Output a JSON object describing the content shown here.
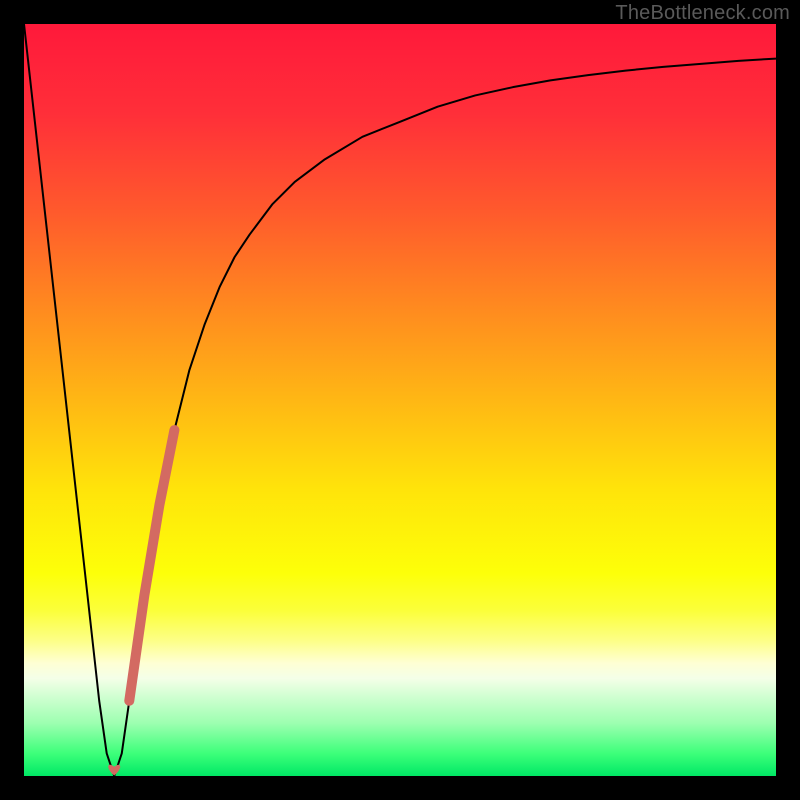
{
  "watermark": "TheBottleneck.com",
  "chart_data": {
    "type": "line",
    "title": "",
    "xlabel": "",
    "ylabel": "",
    "xlim": [
      0,
      100
    ],
    "ylim": [
      0,
      100
    ],
    "gradient_stops": [
      {
        "offset": 0.0,
        "color": "#ff193a"
      },
      {
        "offset": 0.12,
        "color": "#ff2f39"
      },
      {
        "offset": 0.25,
        "color": "#ff5a2c"
      },
      {
        "offset": 0.38,
        "color": "#ff8b1f"
      },
      {
        "offset": 0.5,
        "color": "#ffb714"
      },
      {
        "offset": 0.62,
        "color": "#ffe40a"
      },
      {
        "offset": 0.73,
        "color": "#fdff09"
      },
      {
        "offset": 0.78,
        "color": "#fbff3a"
      },
      {
        "offset": 0.82,
        "color": "#fdff87"
      },
      {
        "offset": 0.85,
        "color": "#feffd4"
      },
      {
        "offset": 0.87,
        "color": "#f4ffe8"
      },
      {
        "offset": 0.93,
        "color": "#9cffb0"
      },
      {
        "offset": 0.97,
        "color": "#3dff7a"
      },
      {
        "offset": 1.0,
        "color": "#00e865"
      }
    ],
    "series": [
      {
        "name": "main-curve",
        "color": "#000000",
        "width": 2.0,
        "x": [
          0,
          1,
          2,
          3,
          4,
          5,
          6,
          7,
          8,
          9,
          10,
          11,
          12,
          13,
          14,
          15,
          16,
          17,
          18,
          20,
          22,
          24,
          26,
          28,
          30,
          33,
          36,
          40,
          45,
          50,
          55,
          60,
          65,
          70,
          75,
          80,
          85,
          90,
          95,
          100
        ],
        "y": [
          100,
          91,
          82,
          73,
          64,
          55,
          46,
          37,
          28,
          19,
          10,
          3,
          0,
          3,
          10,
          17,
          24,
          30,
          36,
          46,
          54,
          60,
          65,
          69,
          72,
          76,
          79,
          82,
          85,
          87,
          89,
          90.5,
          91.6,
          92.5,
          93.2,
          93.8,
          94.3,
          94.7,
          95.1,
          95.4
        ]
      },
      {
        "name": "highlight-segment",
        "color": "#d36a62",
        "width": 10,
        "linecap": "round",
        "x": [
          14.0,
          15.0,
          16.0,
          17.0,
          18.0,
          19.0,
          20.0
        ],
        "y": [
          10.0,
          17.0,
          24.0,
          30.0,
          36.0,
          41.0,
          46.0
        ]
      }
    ],
    "markers": [
      {
        "name": "min-point",
        "shape": "heart",
        "color": "#d36a62",
        "x": 12.0,
        "y": 0.7,
        "size": 16
      }
    ]
  }
}
